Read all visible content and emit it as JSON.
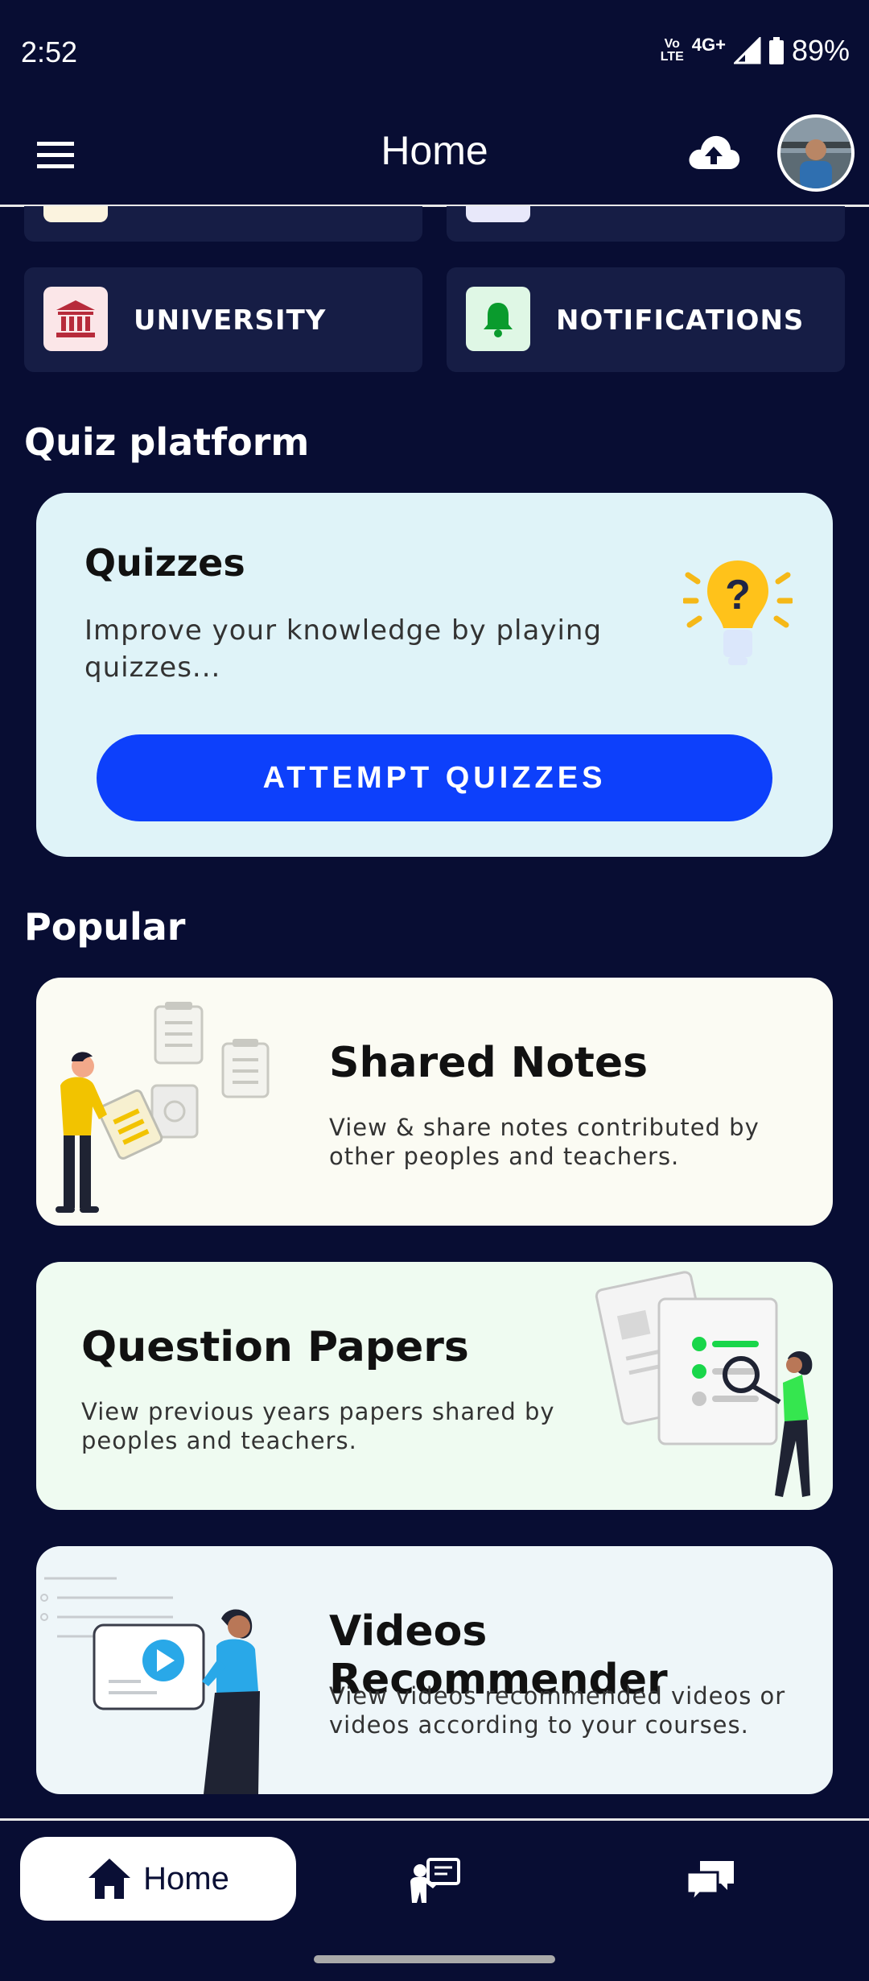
{
  "status_bar": {
    "time": "2:52",
    "volte_top": "Vo",
    "volte_bottom": "LTE",
    "network": "4G+",
    "battery": "89%"
  },
  "app_bar": {
    "title": "Home",
    "icons": [
      "menu-icon",
      "cloud-upload-icon",
      "avatar"
    ]
  },
  "tiles": [
    {
      "label": "UNIVERSITY",
      "icon": "university-icon",
      "icon_bg": "#fbe6e8",
      "icon_color": "#b72b3b"
    },
    {
      "label": "NOTIFICATIONS",
      "icon": "bell-icon",
      "icon_bg": "#dff7e5",
      "icon_color": "#0a9b2d"
    }
  ],
  "quiz_section": {
    "heading": "Quiz platform",
    "card_title": "Quizzes",
    "card_desc": "Improve your knowledge by playing quizzes...",
    "button_label": "ATTEMPT QUIZZES",
    "button_color": "#0d40fb",
    "card_bg": "#dff3f8"
  },
  "popular_section": {
    "heading": "Popular",
    "cards": [
      {
        "title": "Shared Notes",
        "desc": "View & share notes contributed by other peoples and teachers.",
        "bg": "#fbfbf3"
      },
      {
        "title": "Question Papers",
        "desc": "View previous years papers shared by peoples and teachers.",
        "bg": "#effbf1"
      },
      {
        "title": "Videos Recommender",
        "desc": "View videos recommended videos or videos according to your courses.",
        "bg": "#eef6f9"
      }
    ]
  },
  "bottom_nav": {
    "home_label": "Home",
    "items": [
      "home-icon",
      "teacher-icon",
      "chat-icon"
    ]
  }
}
